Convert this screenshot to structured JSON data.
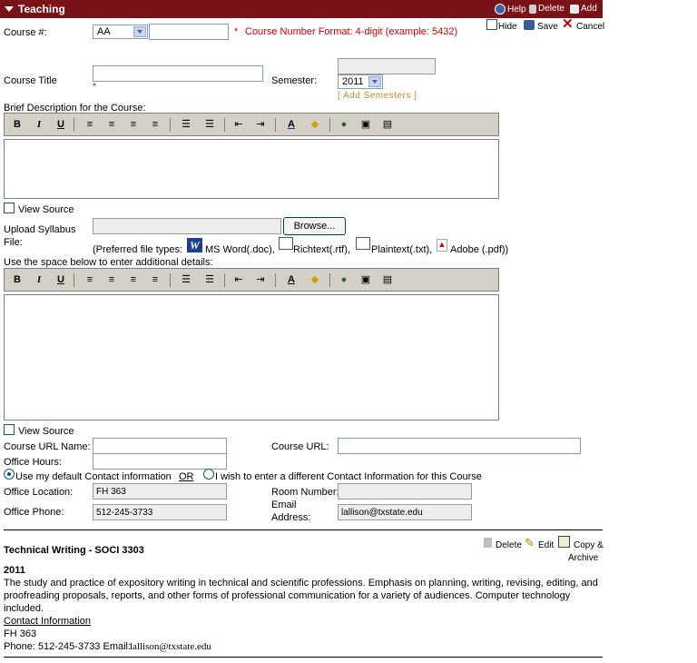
{
  "header": {
    "title": "Teaching",
    "help": "Help",
    "delete": "Delete",
    "add": "Add"
  },
  "actions": {
    "hide": "Hide",
    "save": "Save",
    "cancel": "Cancel"
  },
  "form": {
    "course_num_label": "Course #:",
    "course_prefix": "AA",
    "course_number_value": "",
    "course_number_hint": "Course Number Format: 4-digit (example: 5432)",
    "required_mark": "*",
    "course_title_label": "Course Title",
    "course_title_value": "",
    "semester_label": "Semester:",
    "semester_value": "2011",
    "add_semesters": "[ Add Semesters ]",
    "brief_desc_label": "Brief Description for the Course:",
    "view_source": "View Source",
    "upload_label_line1": "Upload Syllabus",
    "upload_label_line2": "File:",
    "browse": "Browse...",
    "preferred_types": "(Preferred file types:",
    "ft_word": "MS Word(.doc),",
    "ft_rtf": "Richtext(.rtf),",
    "ft_txt": "Plaintext(.txt),",
    "ft_pdf": "Adobe (.pdf))",
    "additional_label": "Use the space below to enter additional details:",
    "course_url_name_label": "Course URL Name:",
    "course_url_label": "Course URL:",
    "office_hours_label": "Office Hours:",
    "radio_default": "Use my default Contact information",
    "or": "OR",
    "radio_different": "I wish to enter a different Contact Information for this Course",
    "office_location_label": "Office Location:",
    "office_location_value": "FH 363",
    "room_number_label": "Room Number:",
    "office_phone_label": "Office Phone:",
    "office_phone_value": "512-245-3733",
    "email_label_line1": "Email",
    "email_label_line2": "Address:",
    "email_value": "lallison@txstate.edu"
  },
  "toolbar_buttons": [
    "B",
    "I",
    "U"
  ],
  "entry": {
    "title": "Technical Writing - SOCI 3303",
    "delete": "Delete",
    "edit": "Edit",
    "copy_line1": "Copy &",
    "copy_line2": "Archive",
    "year": "2011",
    "desc_line1": "The study and practice of expository writing in technical and scientific professions. Emphasis on planning, writing, revising, editing, and",
    "desc_line2": "proofreading proposals, reports, and other forms of professional communication for a variety of audiences. Computer technology",
    "desc_line3": "included.",
    "contact_heading": "Contact Information",
    "location": "FH 363",
    "phone_line": "Phone: 512-245-3733  Email:",
    "email": "lallison@txstate.edu"
  },
  "colors": {
    "header_bg": "#7a1318",
    "hint_red": "#d00000",
    "toolbar_bg": "#d4d0c8"
  }
}
